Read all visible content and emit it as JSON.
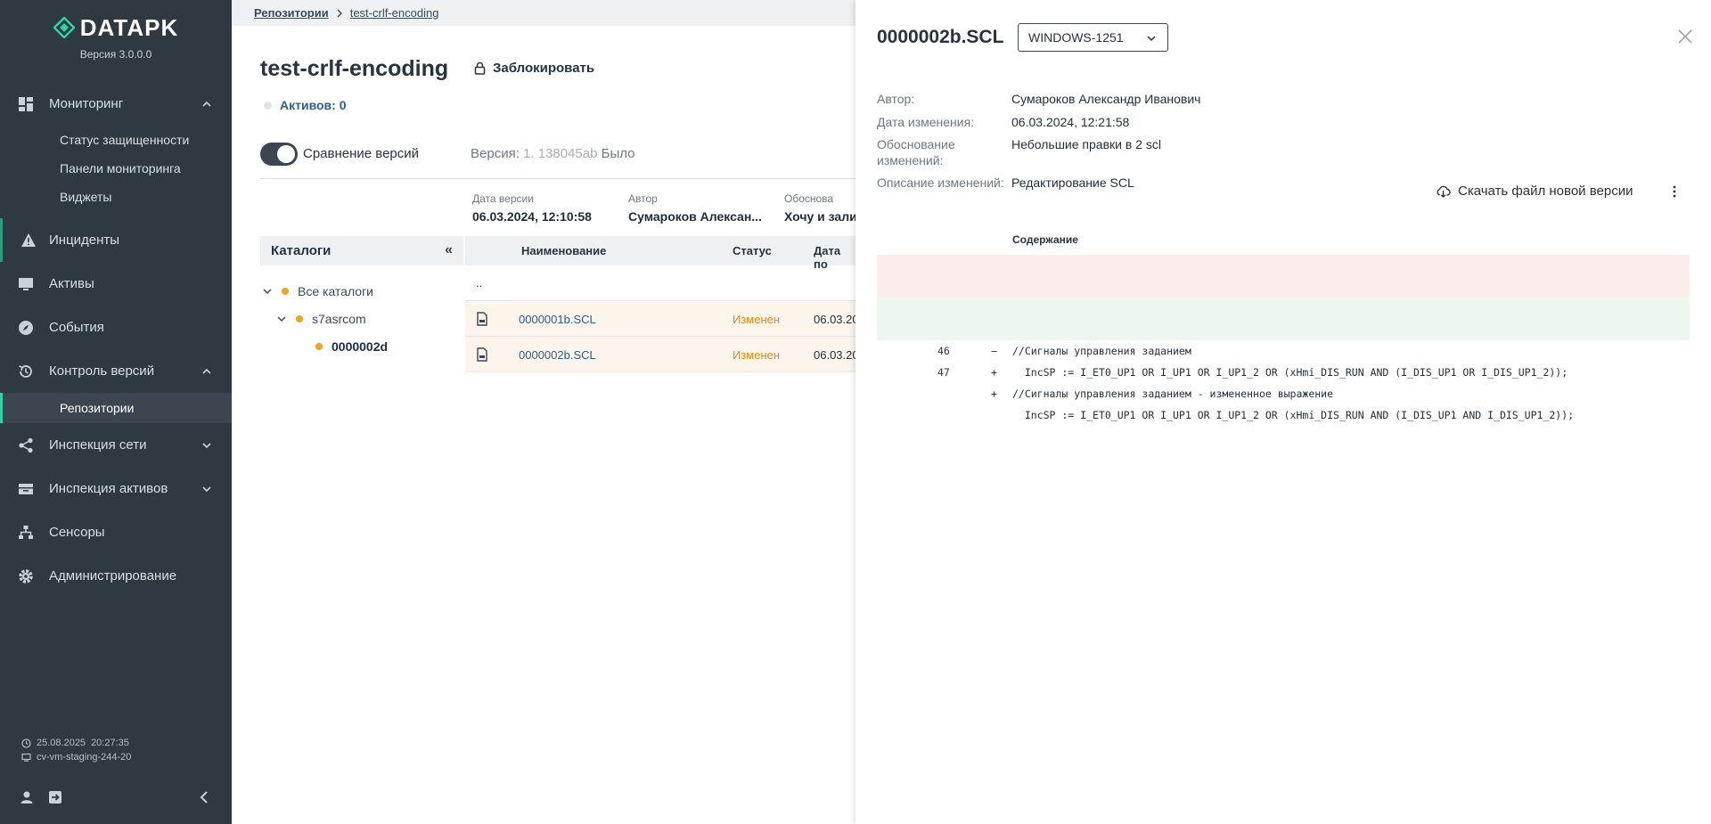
{
  "sidebar": {
    "logo_text": "DATAPK",
    "version": "Версия 3.0.0.0",
    "items": [
      {
        "label": "Мониторинг"
      },
      {
        "label": "Инциденты"
      },
      {
        "label": "Активы"
      },
      {
        "label": "События"
      },
      {
        "label": "Контроль версий"
      },
      {
        "label": "Инспекция сети"
      },
      {
        "label": "Инспекция активов"
      },
      {
        "label": "Сенсоры"
      },
      {
        "label": "Администрирование"
      }
    ],
    "monitoring_sub": [
      "Статус защищенности",
      "Панели мониторинга",
      "Виджеты"
    ],
    "versions_sub": [
      "Репозитории"
    ],
    "footer": {
      "date": "25.08.2025",
      "time": "20:27:35",
      "host": "cv-vm-staging-244-20"
    }
  },
  "main": {
    "breadcrumb": [
      "Репозитории",
      "test-crlf-encoding"
    ],
    "title": "test-crlf-encoding",
    "lock_label": "Заблокировать",
    "assets_label": "Активов: 0",
    "compare_label": "Сравнение версий",
    "version_prefix": "Версия:",
    "version_value": "1. 138045ab",
    "version_suffix": "Было",
    "meta": {
      "date_label": "Дата версии",
      "date_value": "06.03.2024, 12:10:58",
      "author_label": "Автор",
      "author_value": "Сумароков Алексан...",
      "reason_label": "Обоснова",
      "reason_value": "Хочу и зали"
    },
    "catalogs_label": "Каталоги",
    "collapse_glyph": "«",
    "tree": [
      "Все каталоги",
      "s7asrcom",
      "0000002d"
    ],
    "table": {
      "columns": [
        "Наименование",
        "Статус",
        "Дата по"
      ],
      "parent_row": "..",
      "rows": [
        {
          "name": "0000001b.SCL",
          "status": "Изменен",
          "date": "06.03.20"
        },
        {
          "name": "0000002b.SCL",
          "status": "Изменен",
          "date": "06.03.20"
        }
      ]
    }
  },
  "drawer": {
    "title": "0000002b.SCL",
    "encoding": "WINDOWS-1251",
    "author_label": "Автор:",
    "author_value": "Сумароков Александр Иванович",
    "changed_label": "Дата изменения:",
    "changed_value": "06.03.2024, 12:21:58",
    "reason_label": "Обоснование изменений:",
    "reason_value": "Небольшие правки в 2 scl",
    "desc_label": "Описание изменений:",
    "desc_value": "Редактирование SCL",
    "download_label": "Скачать файл новой версии",
    "content_label": "Содержание",
    "diff": [
      {
        "type": "del",
        "old": "46",
        "new": "",
        "sign": "−",
        "code": "//Сигналы управления заданием"
      },
      {
        "type": "del",
        "old": "47",
        "new": "",
        "sign": "−",
        "code": "  IncSP := I_ET0_UP1 OR I_UP1 OR I_UP1_2 OR (xHmi_DIS_RUN AND (I_DIS_UP1 OR I_DIS_UP1_2));"
      },
      {
        "type": "add",
        "old": "",
        "new": "46",
        "sign": "+",
        "code": "//Сигналы управления заданием - измененное выражение"
      },
      {
        "type": "add",
        "old": "",
        "new": "47",
        "sign": "+",
        "code": "  IncSP := I_ET0_UP1 OR I_UP1 OR I_UP1_2 OR (xHmi_DIS_RUN AND (I_DIS_UP1 AND I_DIS_UP1_2));"
      }
    ]
  },
  "colors": {
    "sidebar_bg": "#2f3942",
    "accent": "#2fd4a5",
    "link": "#2c5d93",
    "changed": "#e08a17",
    "diff_del": "#fcecec",
    "diff_add": "#edf6ef"
  }
}
